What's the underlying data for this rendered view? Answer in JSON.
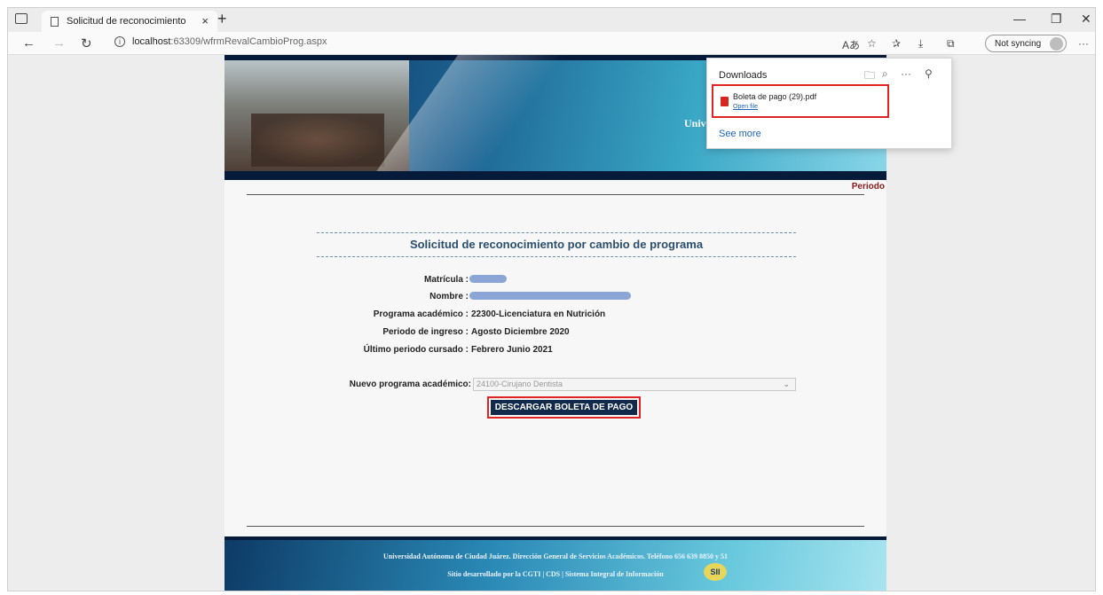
{
  "browser": {
    "tab_title": "Solicitud de reconocimiento",
    "tab_close": "×",
    "new_tab": "+",
    "url_host": "localhost",
    "url_path": ":63309/wfrmRevalCambioProg.aspx",
    "profile_label": "Not syncing",
    "more": "···"
  },
  "downloads": {
    "title": "Downloads",
    "file_name": "Boleta de pago (29).pdf",
    "open_file": "Open file",
    "see_more": "See more"
  },
  "header": {
    "university_partial": "Univ",
    "period_label": "Periodo"
  },
  "form": {
    "title": "Solicitud de reconocimiento por cambio de programa",
    "fields": [
      {
        "label": "Matrícula :",
        "value": ""
      },
      {
        "label": "Nombre :",
        "value": ""
      },
      {
        "label": "Programa académico :",
        "value": "22300-Licenciatura en Nutrición"
      },
      {
        "label": "Periodo de ingreso :",
        "value": "Agosto Diciembre 2020"
      },
      {
        "label": "Último periodo cursado :",
        "value": "Febrero Junio 2021"
      }
    ],
    "new_program_label": "Nuevo programa académico:",
    "new_program_value": "24100-Cirujano Dentista",
    "download_button": "DESCARGAR BOLETA DE PAGO"
  },
  "footer": {
    "line1": "Universidad Autónoma de Ciudad Juárez. Dirección General de Servicios Académicos. Teléfono 656 639 8850 y 51",
    "line2": "Sitio desarrollado por la CGTI | CDS | Sistema Integral de Información",
    "logo_text": "SII"
  },
  "colors": {
    "highlight": "#e02323",
    "button_bg": "#11294a",
    "title_color": "#2b4f6e",
    "period_color": "#8a1a1a"
  }
}
